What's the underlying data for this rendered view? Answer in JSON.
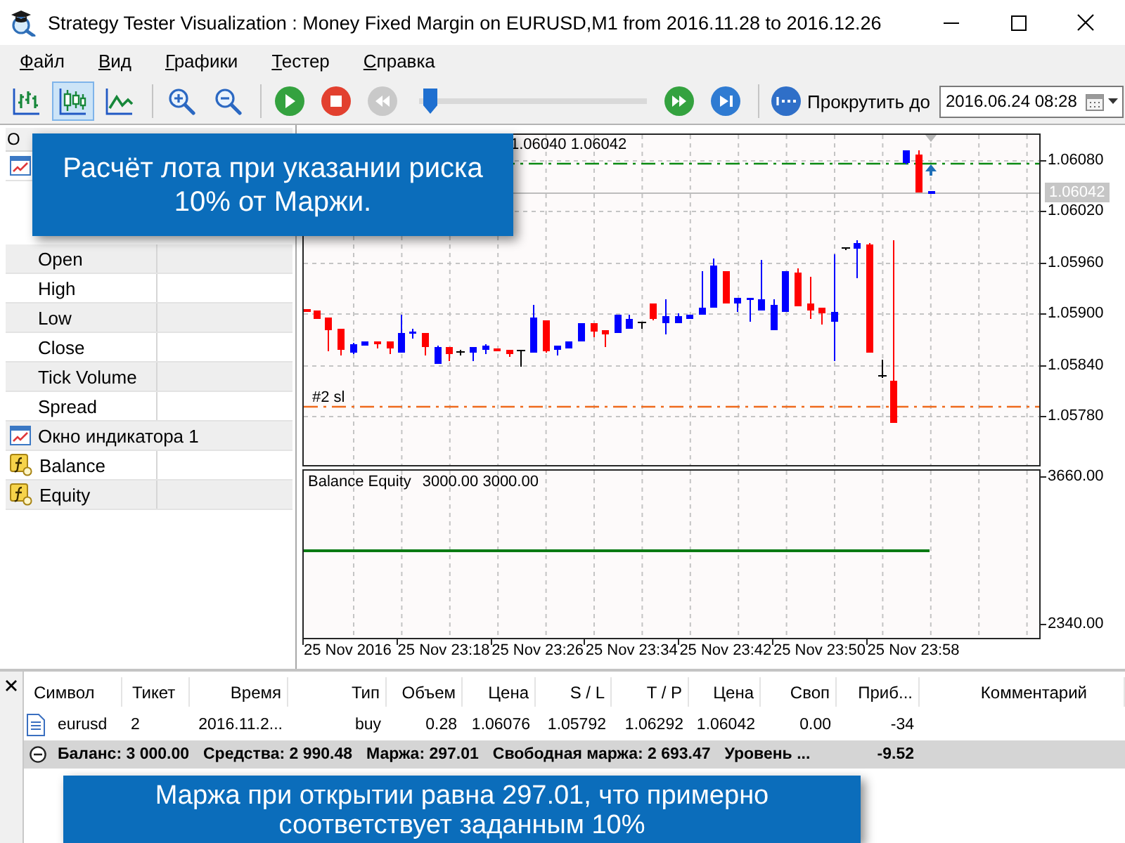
{
  "window": {
    "title": "Strategy Tester Visualization : Money Fixed Margin on EURUSD,M1 from 2016.11.28 to 2016.12.26"
  },
  "menu": [
    "Файл",
    "Вид",
    "Графики",
    "Тестер",
    "Справка"
  ],
  "toolbar": {
    "chart_modes": [
      {
        "kind": "bars",
        "selected": false
      },
      {
        "kind": "candles",
        "selected": true
      },
      {
        "kind": "line",
        "selected": false
      }
    ],
    "playback": [
      {
        "kind": "play",
        "disabled": false
      },
      {
        "kind": "stop",
        "disabled": false
      },
      {
        "kind": "rewind",
        "disabled": true
      }
    ],
    "speed_slider": {
      "level": 0.02
    },
    "stepping": [
      {
        "kind": "fast_forward",
        "disabled": false
      },
      {
        "kind": "skip_to_end",
        "disabled": false
      }
    ],
    "scroll_button": {
      "label": "Прокрутить до"
    },
    "date_field": {
      "value": "2016.06.24 08:28"
    }
  },
  "data_window": {
    "header": "О",
    "rows": [
      {
        "kind": "window"
      },
      {
        "kind": "value",
        "label": "Open"
      },
      {
        "kind": "value",
        "label": "High"
      },
      {
        "kind": "value",
        "label": "Low"
      },
      {
        "kind": "value",
        "label": "Close"
      },
      {
        "kind": "value",
        "label": "Tick Volume"
      },
      {
        "kind": "value",
        "label": "Spread"
      },
      {
        "kind": "window",
        "label": "Окно индикатора 1"
      },
      {
        "kind": "buffer",
        "label": "Balance"
      },
      {
        "kind": "buffer",
        "label": "Equity"
      }
    ]
  },
  "chart": {
    "price_header": "1.06040 1.06042",
    "stop_loss_label": "#2 sl",
    "price_axis": [
      {
        "kind": "tick",
        "label": "1.06080"
      },
      {
        "kind": "current",
        "label": "1.06042"
      },
      {
        "kind": "tick",
        "label": "1.06020"
      },
      {
        "kind": "tick",
        "label": "1.05960"
      },
      {
        "kind": "tick",
        "label": "1.05900"
      },
      {
        "kind": "tick",
        "label": "1.05840"
      },
      {
        "kind": "tick",
        "label": "1.05780"
      }
    ],
    "indicator": {
      "name": "Balance Equity",
      "values": "3000.00 3000.00",
      "axis": [
        "3660.00",
        "2340.00"
      ]
    },
    "time_axis": [
      "25 Nov 2016",
      "25 Nov 23:18",
      "25 Nov 23:26",
      "25 Nov 23:34",
      "25 Nov 23:42",
      "25 Nov 23:50",
      "25 Nov 23:58"
    ]
  },
  "terminal": {
    "columns": [
      "Символ",
      "Тикет",
      "Время",
      "Тип",
      "Объем",
      "Цена",
      "S / L",
      "T / P",
      "Цена",
      "Своп",
      "Приб...",
      "Комментарий"
    ],
    "rows": [
      {
        "cells": [
          "eurusd",
          "2",
          "2016.11.2...",
          "buy",
          "0.28",
          "1.06076",
          "1.05792",
          "1.06292",
          "1.06042",
          "0.00",
          "-34"
        ]
      }
    ],
    "summary": {
      "expanded": true,
      "items": [
        "Баланс: 3 000.00",
        "Средства: 2 990.48",
        "Маржа: 297.01",
        "Свободная маржа: 2 693.47",
        "Уровень ..."
      ],
      "profit": "-9.52"
    }
  },
  "callouts": [
    {
      "text": "Расчёт лота при указании риска 10% от Маржи."
    },
    {
      "text": "Маржа при открытии равна 297.01, что примерно соответствует заданным 10%"
    }
  ]
}
